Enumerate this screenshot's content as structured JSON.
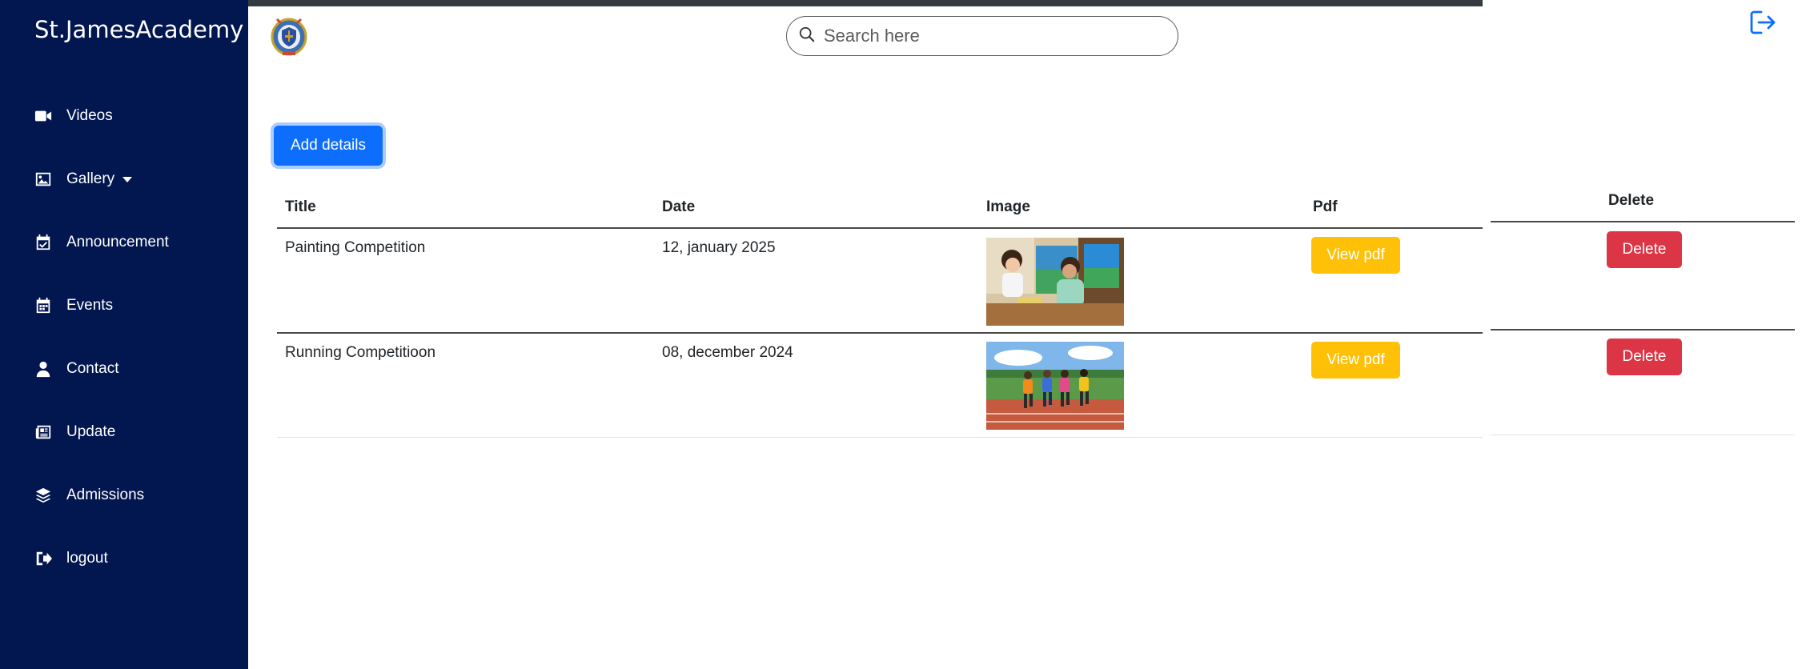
{
  "sidebar": {
    "brand": "St.JamesAcademy",
    "items": [
      {
        "label": "Videos",
        "icon": "video-camera-icon"
      },
      {
        "label": "Gallery",
        "icon": "image-icon",
        "has_dropdown": true
      },
      {
        "label": "Announcement",
        "icon": "calendar-check-icon"
      },
      {
        "label": "Events",
        "icon": "calendar-icon"
      },
      {
        "label": "Contact",
        "icon": "user-icon"
      },
      {
        "label": "Update",
        "icon": "newspaper-icon"
      },
      {
        "label": "Admissions",
        "icon": "layers-icon"
      },
      {
        "label": "logout",
        "icon": "sign-out-icon"
      }
    ]
  },
  "header": {
    "search_placeholder": "Search here"
  },
  "toolbar": {
    "add_label": "Add details"
  },
  "table": {
    "columns": [
      "Title",
      "Date",
      "Image",
      "Pdf",
      "Delete"
    ],
    "rows": [
      {
        "title": "Painting Competition",
        "date": "12, january 2025",
        "image": "painting-thumbnail",
        "pdf_label": "View pdf",
        "delete_label": "Delete"
      },
      {
        "title": "Running Competitioon",
        "date": "08, december 2024",
        "image": "running-thumbnail",
        "pdf_label": "View pdf",
        "delete_label": "Delete"
      }
    ]
  },
  "colors": {
    "sidebar_bg": "#02164f",
    "primary": "#0d6efd",
    "warning": "#ffc107",
    "danger": "#dc3545"
  }
}
